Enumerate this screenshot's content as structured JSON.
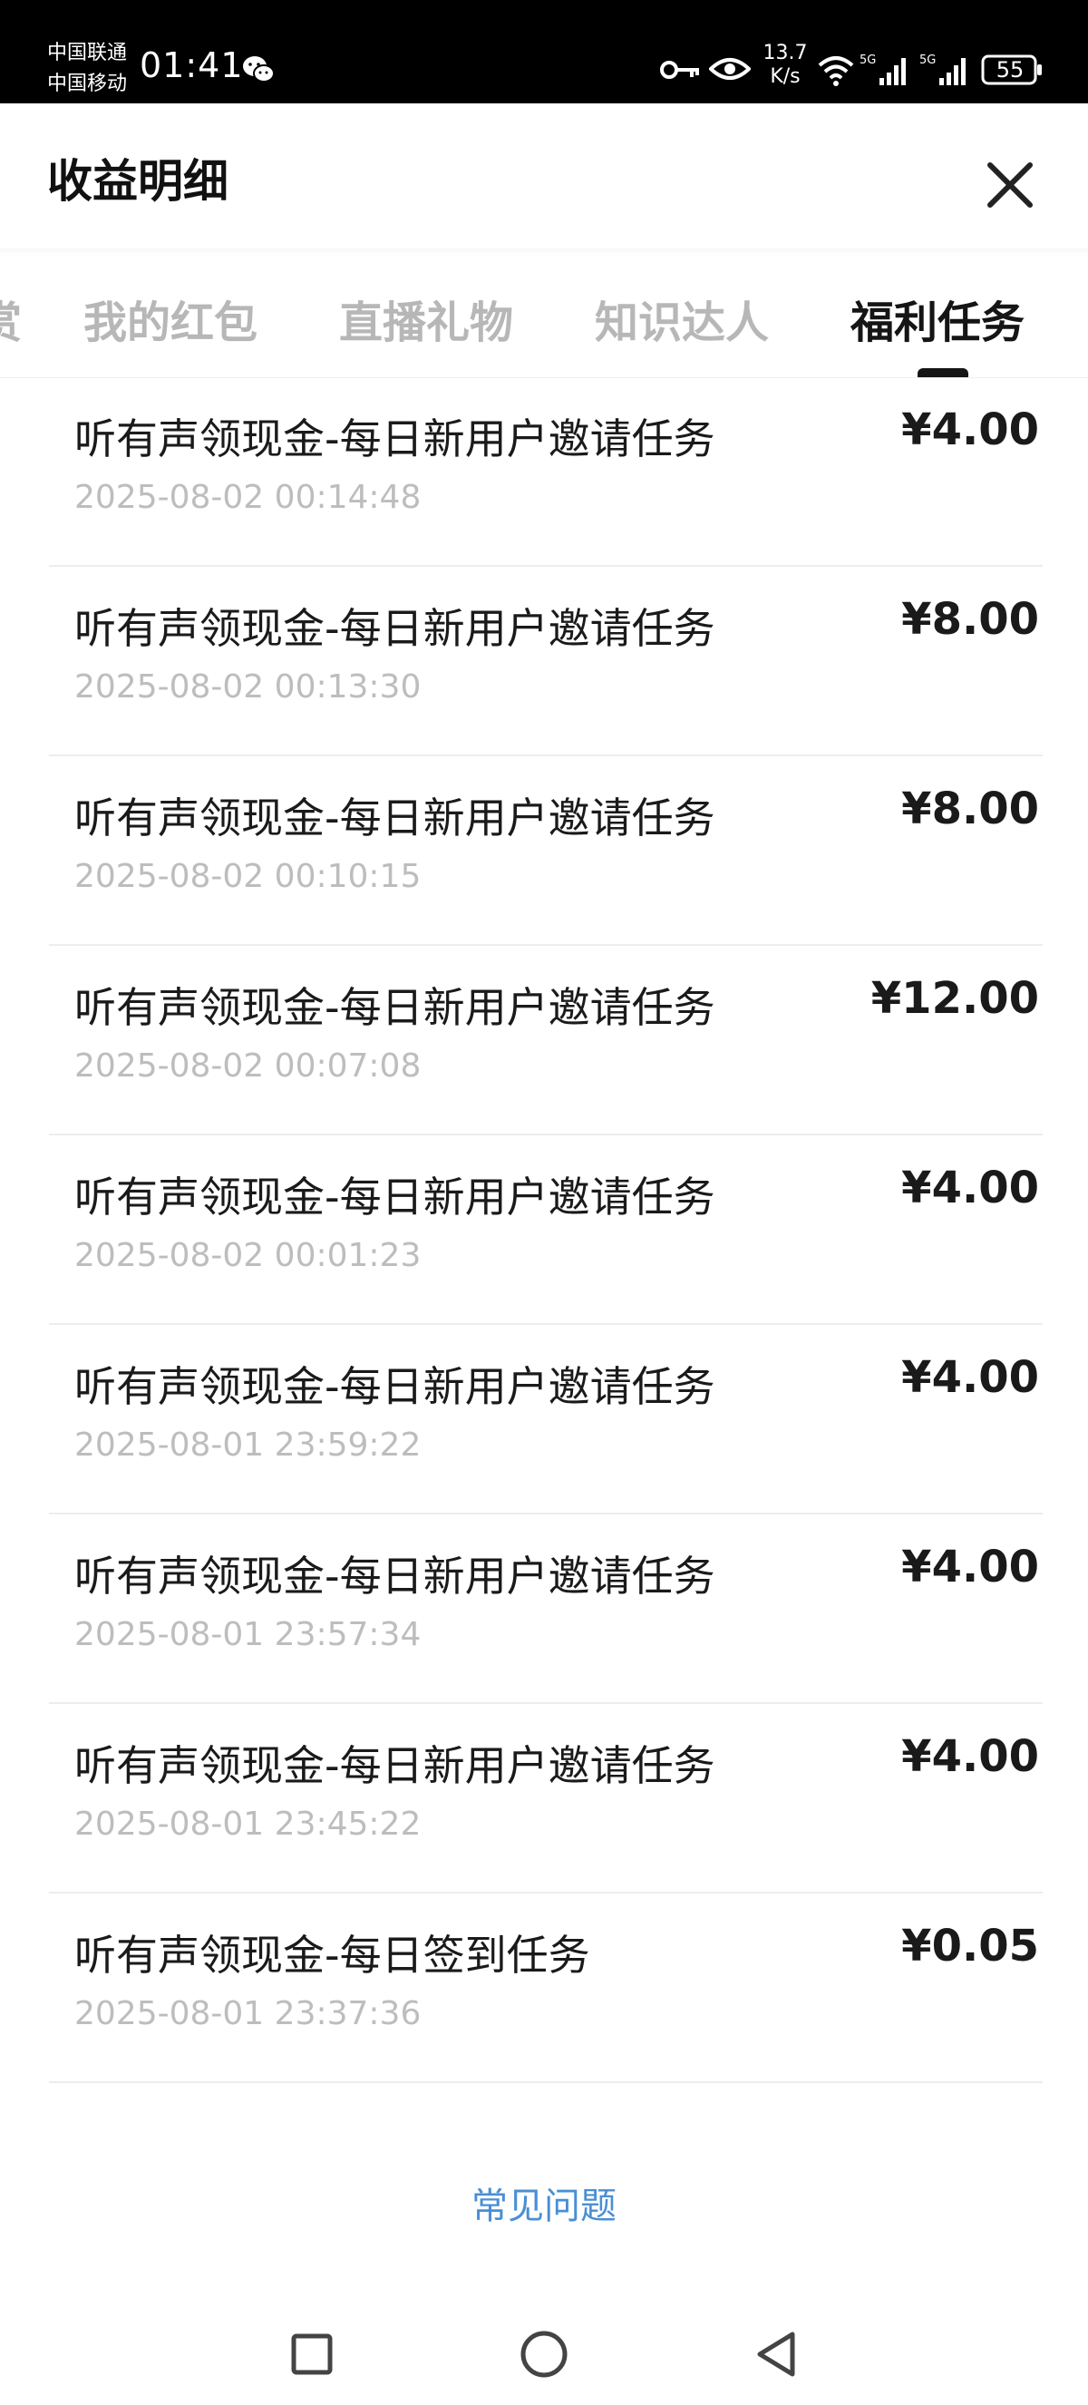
{
  "status_bar": {
    "carrier_1": "中国联通",
    "carrier_2": "中国移动",
    "time": "01:41",
    "net_speed_value": "13.7",
    "net_speed_unit": "K/s",
    "signal_label": "5G",
    "battery": "55"
  },
  "header": {
    "title": "收益明细"
  },
  "tabs": [
    {
      "label": "赏",
      "active": false
    },
    {
      "label": "我的红包",
      "active": false
    },
    {
      "label": "直播礼物",
      "active": false
    },
    {
      "label": "知识达人",
      "active": false
    },
    {
      "label": "福利任务",
      "active": true
    }
  ],
  "records": [
    {
      "title": "听有声领现金-每日新用户邀请任务",
      "time": "2025-08-02 00:14:48",
      "amount": "¥4.00"
    },
    {
      "title": "听有声领现金-每日新用户邀请任务",
      "time": "2025-08-02 00:13:30",
      "amount": "¥8.00"
    },
    {
      "title": "听有声领现金-每日新用户邀请任务",
      "time": "2025-08-02 00:10:15",
      "amount": "¥8.00"
    },
    {
      "title": "听有声领现金-每日新用户邀请任务",
      "time": "2025-08-02 00:07:08",
      "amount": "¥12.00"
    },
    {
      "title": "听有声领现金-每日新用户邀请任务",
      "time": "2025-08-02 00:01:23",
      "amount": "¥4.00"
    },
    {
      "title": "听有声领现金-每日新用户邀请任务",
      "time": "2025-08-01 23:59:22",
      "amount": "¥4.00"
    },
    {
      "title": "听有声领现金-每日新用户邀请任务",
      "time": "2025-08-01 23:57:34",
      "amount": "¥4.00"
    },
    {
      "title": "听有声领现金-每日新用户邀请任务",
      "time": "2025-08-01 23:45:22",
      "amount": "¥4.00"
    },
    {
      "title": "听有声领现金-每日签到任务",
      "time": "2025-08-01 23:37:36",
      "amount": "¥0.05"
    }
  ],
  "footer": {
    "faq_label": "常见问题"
  },
  "colors": {
    "link": "#4a8fd4",
    "tab_inactive": "#b7b7b7",
    "tab_active": "#151515",
    "timestamp": "#bdbdbd"
  }
}
